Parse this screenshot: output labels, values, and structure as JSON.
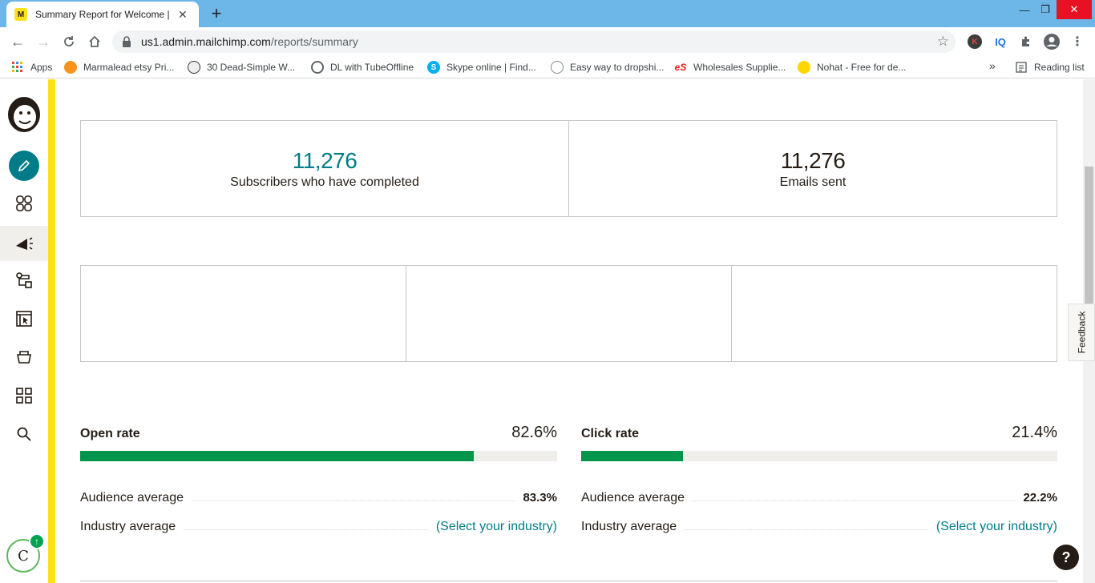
{
  "browser": {
    "tab_title": "Summary Report for Welcome | M",
    "tab_favicon": "M",
    "url_host": "us1.admin.mailchimp.com",
    "url_path": "/reports/summary",
    "ext_k": "K",
    "ext_iq": "IQ",
    "reading_list": "Reading list",
    "overflow": "»"
  },
  "bookmarks": [
    {
      "label": "Apps"
    },
    {
      "label": "Marmalead etsy Pri..."
    },
    {
      "label": "30 Dead-Simple W..."
    },
    {
      "label": "DL with TubeOffline"
    },
    {
      "label": "Skype online | Find..."
    },
    {
      "label": "Easy way to dropshi..."
    },
    {
      "label": "Wholesales Supplie..."
    },
    {
      "label": "Nohat - Free for de..."
    }
  ],
  "sidebar": {
    "avatar_initial": "C",
    "badge_icon": "arrow-up-icon"
  },
  "stats": {
    "completed_value": "11,276",
    "completed_label": "Subscribers who have completed",
    "sent_value": "11,276",
    "sent_label": "Emails sent"
  },
  "open_rate": {
    "title": "Open rate",
    "value": "82.6%",
    "fill_percent": 82.6,
    "audience_label": "Audience average",
    "audience_value": "83.3%",
    "industry_label": "Industry average",
    "industry_link": "(Select your industry)"
  },
  "click_rate": {
    "title": "Click rate",
    "value": "21.4%",
    "fill_percent": 21.4,
    "audience_label": "Audience average",
    "audience_value": "22.2%",
    "industry_label": "Industry average",
    "industry_link": "(Select your industry)"
  },
  "widgets": {
    "feedback": "Feedback",
    "help": "?"
  },
  "colors": {
    "brand_yellow": "#ffe01b",
    "teal": "#007c89",
    "bar_green": "#00954a"
  }
}
